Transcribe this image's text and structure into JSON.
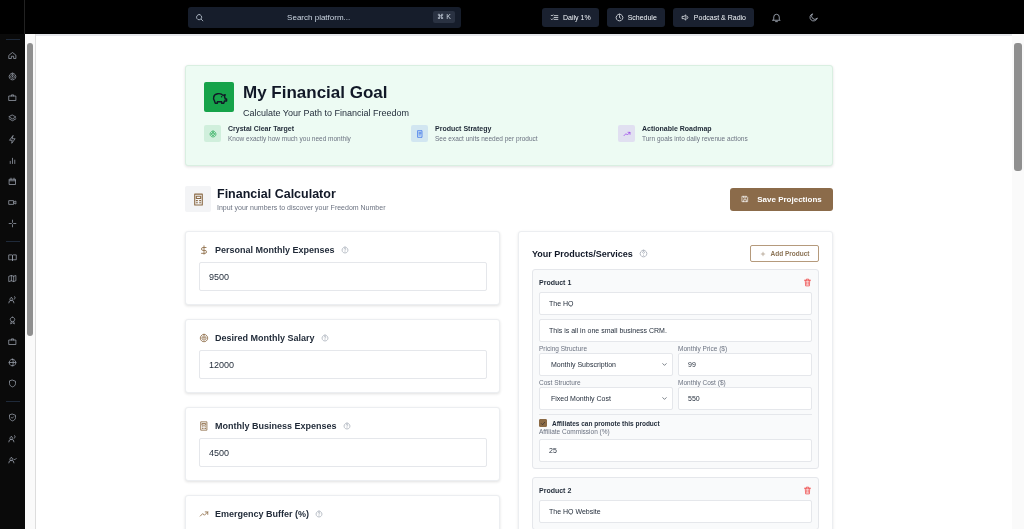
{
  "topbar": {
    "search": {
      "placeholder": "Search platform...",
      "shortcut": "⌘ K"
    },
    "buttons": [
      {
        "label": "Daily 1%",
        "kind": "checklist"
      },
      {
        "label": "Schedule",
        "kind": "clock"
      },
      {
        "label": "Podcast & Radio",
        "kind": "speaker"
      }
    ]
  },
  "hero": {
    "title": "My Financial Goal",
    "subtitle": "Calculate Your Path to Financial Freedom",
    "features": [
      {
        "title": "Crystal Clear Target",
        "description": "Know exactly how much you need monthly",
        "kind": "target"
      },
      {
        "title": "Product Strategy",
        "description": "See exact units needed per product",
        "kind": "document"
      },
      {
        "title": "Actionable Roadmap",
        "description": "Turn goals into daily revenue actions",
        "kind": "trend"
      }
    ]
  },
  "calculator": {
    "title": "Financial Calculator",
    "subtitle": "Input your numbers to discover your Freedom Number",
    "save_button": "Save Projections"
  },
  "inputs": [
    {
      "label": "Personal Monthly Expenses",
      "value": "9500",
      "kind": "dollar"
    },
    {
      "label": "Desired Monthly Salary",
      "value": "12000",
      "kind": "target"
    },
    {
      "label": "Monthly Business Expenses",
      "value": "4500",
      "kind": "calculator"
    },
    {
      "label": "Emergency Buffer (%)",
      "kind": "trend"
    }
  ],
  "products": {
    "title": "Your Products/Services",
    "add_button": "Add Product",
    "items": [
      {
        "heading": "Product 1",
        "name": "The HQ",
        "description": "This is all in one small business CRM.",
        "pricing_label": "Pricing Structure",
        "pricing": "Monthly Subscription",
        "price_label": "Monthly Price ($)",
        "price": "99",
        "cost_structure_label": "Cost Structure",
        "cost_structure": "Fixed Monthly Cost",
        "cost_label": "Monthly Cost ($)",
        "cost": "550",
        "affiliate_label": "Affiliates can promote this product",
        "affiliates": true,
        "commission_label": "Affiliate Commission (%)",
        "commission": "25"
      },
      {
        "heading": "Product 2",
        "name": "The HQ Website"
      }
    ]
  }
}
